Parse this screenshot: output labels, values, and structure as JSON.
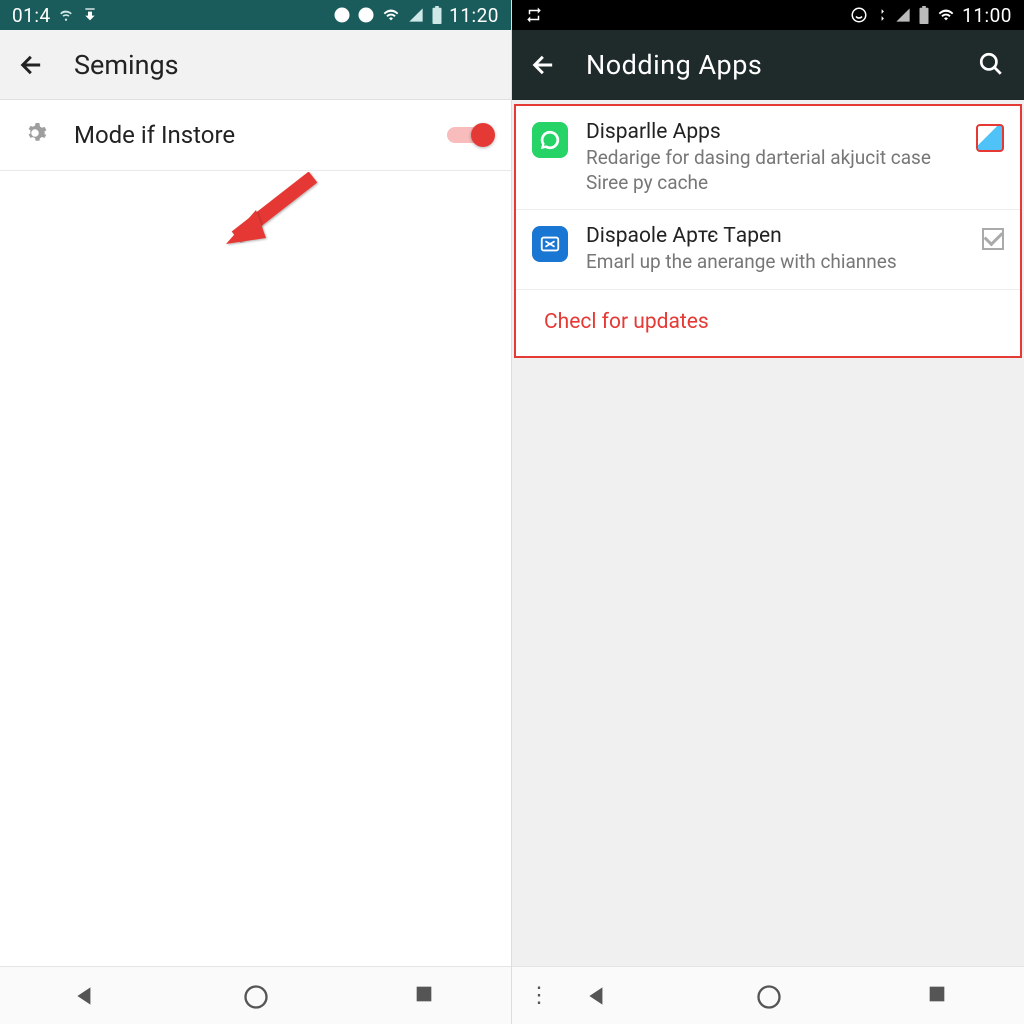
{
  "left": {
    "status": {
      "time_left": "01:4",
      "time_right": "11:20"
    },
    "appbar": {
      "title": "Semings"
    },
    "row": {
      "label": "Mode if Instore"
    }
  },
  "right": {
    "status": {
      "time_right": "11:00"
    },
    "appbar": {
      "title": "Nodding Apps"
    },
    "items": [
      {
        "title": "Disparlle Apps",
        "sub": "Redarige for dasing darterial akjucit case Siree py cache"
      },
      {
        "title": "Dispaole Apтє Тapen",
        "sub": "Emarl up the anerange with chiannes"
      }
    ],
    "check": "Checl for updates"
  }
}
